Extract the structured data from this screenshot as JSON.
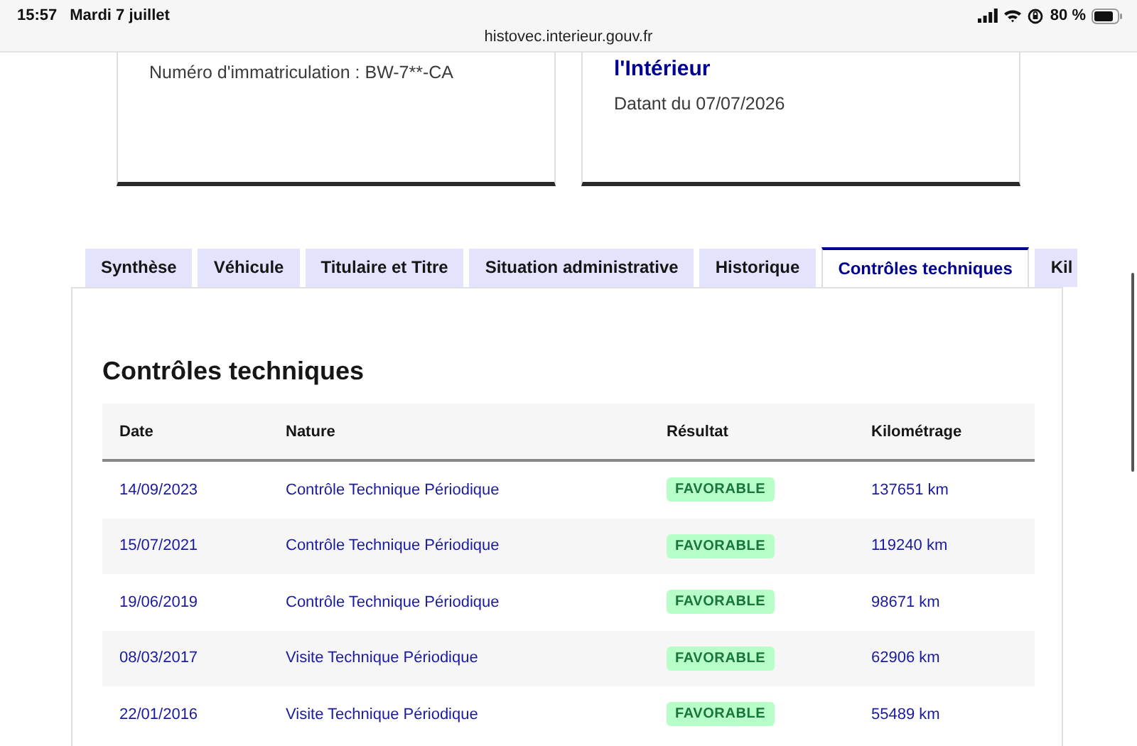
{
  "status_bar": {
    "time": "15:57",
    "date": "Mardi 7 juillet",
    "battery": "80 %"
  },
  "address_bar": {
    "url": "histovec.interieur.gouv.fr"
  },
  "cards": [
    {
      "lines": [
        {
          "kind": "text",
          "text": "Numéro d'immatriculation : BW-7**-CA"
        }
      ]
    },
    {
      "lines": [
        {
          "kind": "title",
          "text": "l'Intérieur"
        },
        {
          "kind": "text",
          "text": "Datant du 07/07/2026"
        }
      ]
    }
  ],
  "tabs": [
    {
      "label": "Synthèse",
      "selected": false
    },
    {
      "label": "Véhicule",
      "selected": false
    },
    {
      "label": "Titulaire et Titre",
      "selected": false
    },
    {
      "label": "Situation administrative",
      "selected": false
    },
    {
      "label": "Historique",
      "selected": false
    },
    {
      "label": "Contrôles techniques",
      "selected": true
    },
    {
      "label": "Kil",
      "selected": false
    }
  ],
  "section": {
    "title": "Contrôles techniques"
  },
  "table": {
    "columns": [
      "Date",
      "Nature",
      "Résultat",
      "Kilométrage"
    ],
    "rows": [
      {
        "date": "14/09/2023",
        "nature": "Contrôle Technique Périodique",
        "result": "FAVORABLE",
        "mileage": "137651 km"
      },
      {
        "date": "15/07/2021",
        "nature": "Contrôle Technique Périodique",
        "result": "FAVORABLE",
        "mileage": "119240 km"
      },
      {
        "date": "19/06/2019",
        "nature": "Contrôle Technique Périodique",
        "result": "FAVORABLE",
        "mileage": "98671 km"
      },
      {
        "date": "08/03/2017",
        "nature": "Visite Technique Périodique",
        "result": "FAVORABLE",
        "mileage": "62906 km"
      },
      {
        "date": "22/01/2016",
        "nature": "Visite Technique Périodique",
        "result": "FAVORABLE",
        "mileage": "55489 km"
      }
    ]
  }
}
